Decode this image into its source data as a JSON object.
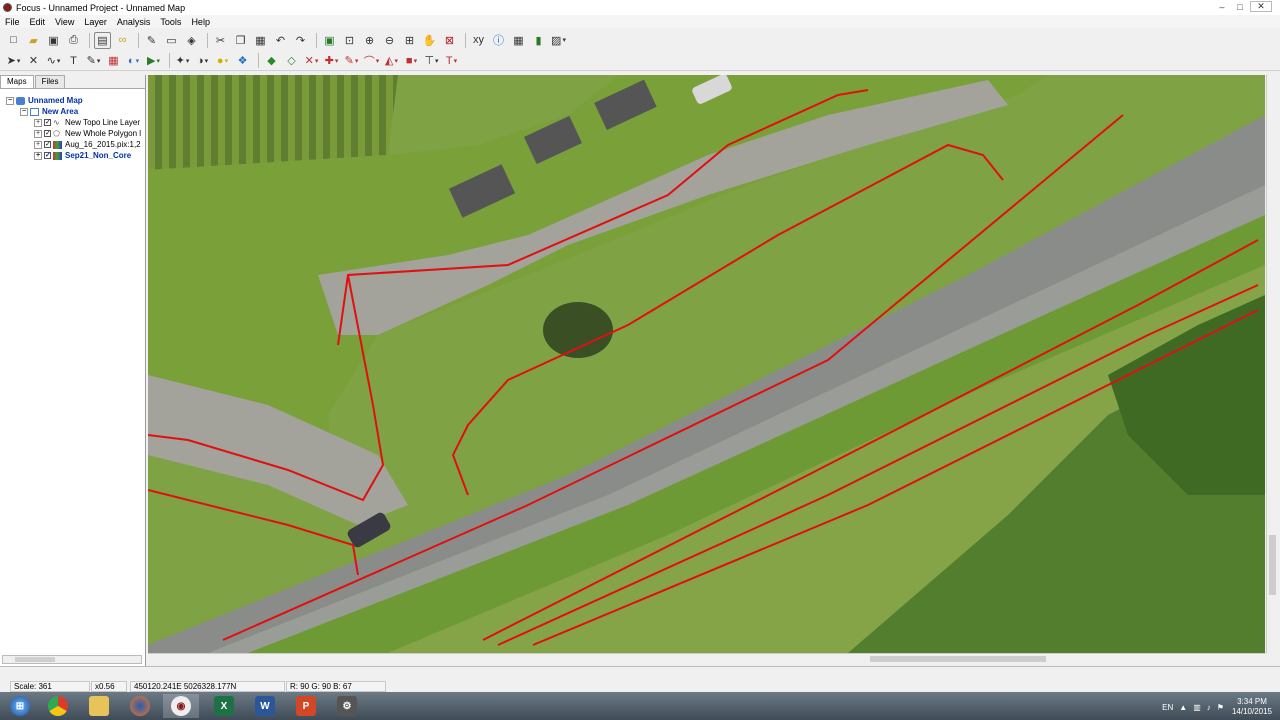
{
  "window": {
    "title": "Focus - Unnamed Project - Unnamed Map",
    "buttons": [
      "–",
      "□",
      "✕"
    ]
  },
  "menu": [
    "File",
    "Edit",
    "View",
    "Layer",
    "Analysis",
    "Tools",
    "Help"
  ],
  "left_panel": {
    "tabs": [
      "Maps",
      "Files"
    ],
    "tree": [
      {
        "label": "Unnamed Map",
        "style": "blue"
      },
      {
        "label": "New Area",
        "style": "blue"
      },
      {
        "label": "New Topo Line Layer",
        "style": "plain"
      },
      {
        "label": "New Whole Polygon l",
        "style": "plain"
      },
      {
        "label": "Aug_16_2015.pix:1,2",
        "style": "plain"
      },
      {
        "label": "Sep21_Non_Core",
        "style": "blue"
      }
    ]
  },
  "status": {
    "scale": "Scale: 361",
    "zoom": "x0.56",
    "coords": "450120.241E 5026328.177N",
    "rgb": "R: 90 G: 90 B: 67"
  },
  "taskbar": {
    "lang": "EN",
    "time": "3:34 PM",
    "date": "14/10/2015"
  },
  "colors": {
    "vector_line": "#e01010",
    "grass": "#7fa344",
    "road": "#8a8c8a",
    "gravel": "#a3a39b"
  }
}
